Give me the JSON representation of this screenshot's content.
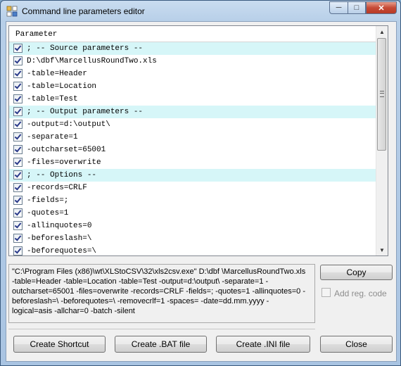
{
  "window": {
    "title": "Command line parameters editor",
    "controls": {
      "minimize": "─",
      "maximize": "□",
      "close": "✕"
    }
  },
  "grid": {
    "column_header": "Parameter",
    "rows": [
      {
        "text": "; -- Source parameters --",
        "checked": true,
        "section": true
      },
      {
        "text": "D:\\dbf\\MarcellusRoundTwo.xls",
        "checked": true,
        "section": false
      },
      {
        "text": "-table=Header",
        "checked": true,
        "section": false
      },
      {
        "text": "-table=Location",
        "checked": true,
        "section": false
      },
      {
        "text": "-table=Test",
        "checked": true,
        "section": false
      },
      {
        "text": "; -- Output parameters --",
        "checked": true,
        "section": true
      },
      {
        "text": "-output=d:\\output\\",
        "checked": true,
        "section": false
      },
      {
        "text": "-separate=1",
        "checked": true,
        "section": false
      },
      {
        "text": "-outcharset=65001",
        "checked": true,
        "section": false
      },
      {
        "text": "-files=overwrite",
        "checked": true,
        "section": false
      },
      {
        "text": "; -- Options --",
        "checked": true,
        "section": true
      },
      {
        "text": "-records=CRLF",
        "checked": true,
        "section": false
      },
      {
        "text": "-fields=;",
        "checked": true,
        "section": false
      },
      {
        "text": "-quotes=1",
        "checked": true,
        "section": false
      },
      {
        "text": "-allinquotes=0",
        "checked": true,
        "section": false
      },
      {
        "text": "-beforeslash=\\",
        "checked": true,
        "section": false
      },
      {
        "text": "-beforequotes=\\",
        "checked": true,
        "section": false
      }
    ],
    "scroll_position": 0
  },
  "command_line": "\"C:\\Program Files (x86)\\wt\\XLStoCSV\\32\\xls2csv.exe\" D:\\dbf \\MarcellusRoundTwo.xls -table=Header -table=Location -table=Test -output=d:\\output\\ -separate=1 -outcharset=65001 -files=overwrite -records=CRLF -fields=; -quotes=1 -allinquotes=0 -beforeslash=\\ -beforequotes=\\ -removecrlf=1 -spaces= -date=dd.mm.yyyy -logical=asis -allchar=0 -batch -silent",
  "buttons": {
    "copy": "Copy",
    "add_reg_code": "Add reg. code",
    "create_shortcut": "Create Shortcut",
    "create_bat": "Create .BAT file",
    "create_ini": "Create .INI file",
    "close": "Close"
  },
  "add_reg_code_checked": false,
  "icons": {
    "app": "app-icon",
    "checkbox": "checkmark-icon"
  }
}
